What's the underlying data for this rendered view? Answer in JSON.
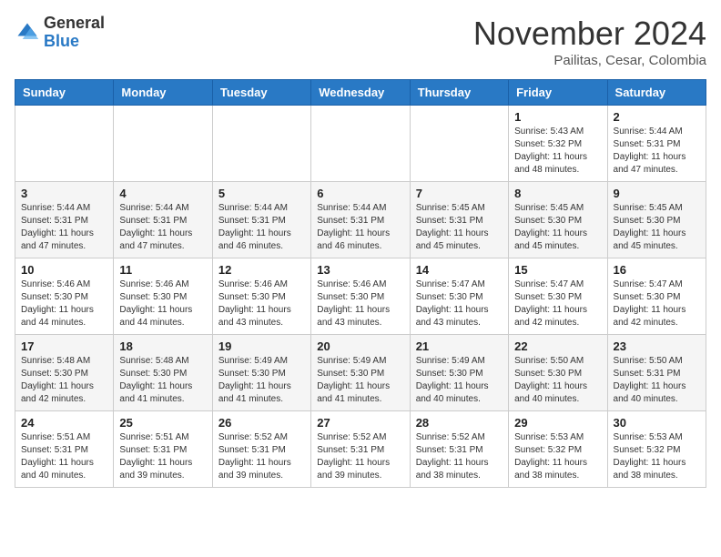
{
  "header": {
    "logo_general": "General",
    "logo_blue": "Blue",
    "month_title": "November 2024",
    "location": "Pailitas, Cesar, Colombia"
  },
  "calendar": {
    "days_of_week": [
      "Sunday",
      "Monday",
      "Tuesday",
      "Wednesday",
      "Thursday",
      "Friday",
      "Saturday"
    ],
    "weeks": [
      [
        {
          "day": "",
          "info": ""
        },
        {
          "day": "",
          "info": ""
        },
        {
          "day": "",
          "info": ""
        },
        {
          "day": "",
          "info": ""
        },
        {
          "day": "",
          "info": ""
        },
        {
          "day": "1",
          "info": "Sunrise: 5:43 AM\nSunset: 5:32 PM\nDaylight: 11 hours\nand 48 minutes."
        },
        {
          "day": "2",
          "info": "Sunrise: 5:44 AM\nSunset: 5:31 PM\nDaylight: 11 hours\nand 47 minutes."
        }
      ],
      [
        {
          "day": "3",
          "info": "Sunrise: 5:44 AM\nSunset: 5:31 PM\nDaylight: 11 hours\nand 47 minutes."
        },
        {
          "day": "4",
          "info": "Sunrise: 5:44 AM\nSunset: 5:31 PM\nDaylight: 11 hours\nand 47 minutes."
        },
        {
          "day": "5",
          "info": "Sunrise: 5:44 AM\nSunset: 5:31 PM\nDaylight: 11 hours\nand 46 minutes."
        },
        {
          "day": "6",
          "info": "Sunrise: 5:44 AM\nSunset: 5:31 PM\nDaylight: 11 hours\nand 46 minutes."
        },
        {
          "day": "7",
          "info": "Sunrise: 5:45 AM\nSunset: 5:31 PM\nDaylight: 11 hours\nand 45 minutes."
        },
        {
          "day": "8",
          "info": "Sunrise: 5:45 AM\nSunset: 5:30 PM\nDaylight: 11 hours\nand 45 minutes."
        },
        {
          "day": "9",
          "info": "Sunrise: 5:45 AM\nSunset: 5:30 PM\nDaylight: 11 hours\nand 45 minutes."
        }
      ],
      [
        {
          "day": "10",
          "info": "Sunrise: 5:46 AM\nSunset: 5:30 PM\nDaylight: 11 hours\nand 44 minutes."
        },
        {
          "day": "11",
          "info": "Sunrise: 5:46 AM\nSunset: 5:30 PM\nDaylight: 11 hours\nand 44 minutes."
        },
        {
          "day": "12",
          "info": "Sunrise: 5:46 AM\nSunset: 5:30 PM\nDaylight: 11 hours\nand 43 minutes."
        },
        {
          "day": "13",
          "info": "Sunrise: 5:46 AM\nSunset: 5:30 PM\nDaylight: 11 hours\nand 43 minutes."
        },
        {
          "day": "14",
          "info": "Sunrise: 5:47 AM\nSunset: 5:30 PM\nDaylight: 11 hours\nand 43 minutes."
        },
        {
          "day": "15",
          "info": "Sunrise: 5:47 AM\nSunset: 5:30 PM\nDaylight: 11 hours\nand 42 minutes."
        },
        {
          "day": "16",
          "info": "Sunrise: 5:47 AM\nSunset: 5:30 PM\nDaylight: 11 hours\nand 42 minutes."
        }
      ],
      [
        {
          "day": "17",
          "info": "Sunrise: 5:48 AM\nSunset: 5:30 PM\nDaylight: 11 hours\nand 42 minutes."
        },
        {
          "day": "18",
          "info": "Sunrise: 5:48 AM\nSunset: 5:30 PM\nDaylight: 11 hours\nand 41 minutes."
        },
        {
          "day": "19",
          "info": "Sunrise: 5:49 AM\nSunset: 5:30 PM\nDaylight: 11 hours\nand 41 minutes."
        },
        {
          "day": "20",
          "info": "Sunrise: 5:49 AM\nSunset: 5:30 PM\nDaylight: 11 hours\nand 41 minutes."
        },
        {
          "day": "21",
          "info": "Sunrise: 5:49 AM\nSunset: 5:30 PM\nDaylight: 11 hours\nand 40 minutes."
        },
        {
          "day": "22",
          "info": "Sunrise: 5:50 AM\nSunset: 5:30 PM\nDaylight: 11 hours\nand 40 minutes."
        },
        {
          "day": "23",
          "info": "Sunrise: 5:50 AM\nSunset: 5:31 PM\nDaylight: 11 hours\nand 40 minutes."
        }
      ],
      [
        {
          "day": "24",
          "info": "Sunrise: 5:51 AM\nSunset: 5:31 PM\nDaylight: 11 hours\nand 40 minutes."
        },
        {
          "day": "25",
          "info": "Sunrise: 5:51 AM\nSunset: 5:31 PM\nDaylight: 11 hours\nand 39 minutes."
        },
        {
          "day": "26",
          "info": "Sunrise: 5:52 AM\nSunset: 5:31 PM\nDaylight: 11 hours\nand 39 minutes."
        },
        {
          "day": "27",
          "info": "Sunrise: 5:52 AM\nSunset: 5:31 PM\nDaylight: 11 hours\nand 39 minutes."
        },
        {
          "day": "28",
          "info": "Sunrise: 5:52 AM\nSunset: 5:31 PM\nDaylight: 11 hours\nand 38 minutes."
        },
        {
          "day": "29",
          "info": "Sunrise: 5:53 AM\nSunset: 5:32 PM\nDaylight: 11 hours\nand 38 minutes."
        },
        {
          "day": "30",
          "info": "Sunrise: 5:53 AM\nSunset: 5:32 PM\nDaylight: 11 hours\nand 38 minutes."
        }
      ]
    ]
  }
}
